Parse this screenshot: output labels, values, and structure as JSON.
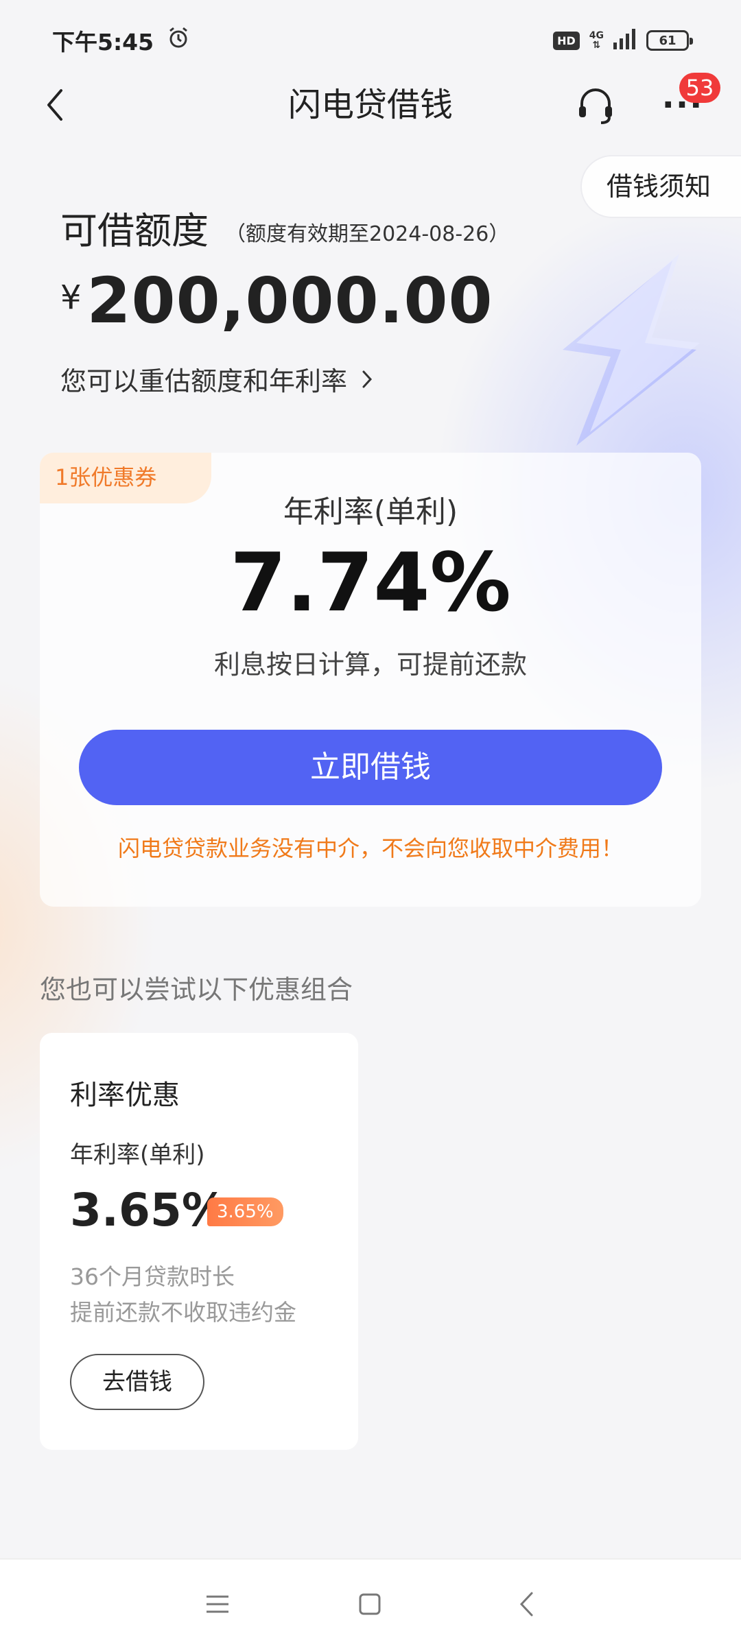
{
  "status_bar": {
    "time": "下午5:45",
    "hd": "HD",
    "network": "4G",
    "battery": "61"
  },
  "nav": {
    "title": "闪电贷借钱",
    "notification_count": "53"
  },
  "notice_button": "借钱须知",
  "quota": {
    "label": "可借额度",
    "validity": "（额度有效期至2024-08-26）",
    "currency": "¥",
    "amount": "200,000.00",
    "reassess_link": "您可以重估额度和年利率"
  },
  "main_card": {
    "coupon_tag": "1张优惠券",
    "rate_label": "年利率(单利)",
    "rate_value": "7.74%",
    "rate_note": "利息按日计算，可提前还款",
    "borrow_button": "立即借钱",
    "disclaimer": "闪电贷贷款业务没有中介，不会向您收取中介费用！"
  },
  "combo_title": "您也可以尝试以下优惠组合",
  "offer_card": {
    "title": "利率优惠",
    "rate_label": "年利率(单利)",
    "rate_value": "3.65%",
    "rate_tag": "3.65%",
    "desc_line1": "36个月贷款时长",
    "desc_line2": "提前还款不收取违约金",
    "button": "去借钱"
  },
  "colors": {
    "primary": "#5263f3",
    "accent_orange": "#f07a1a",
    "badge_red": "#f03a3a"
  }
}
